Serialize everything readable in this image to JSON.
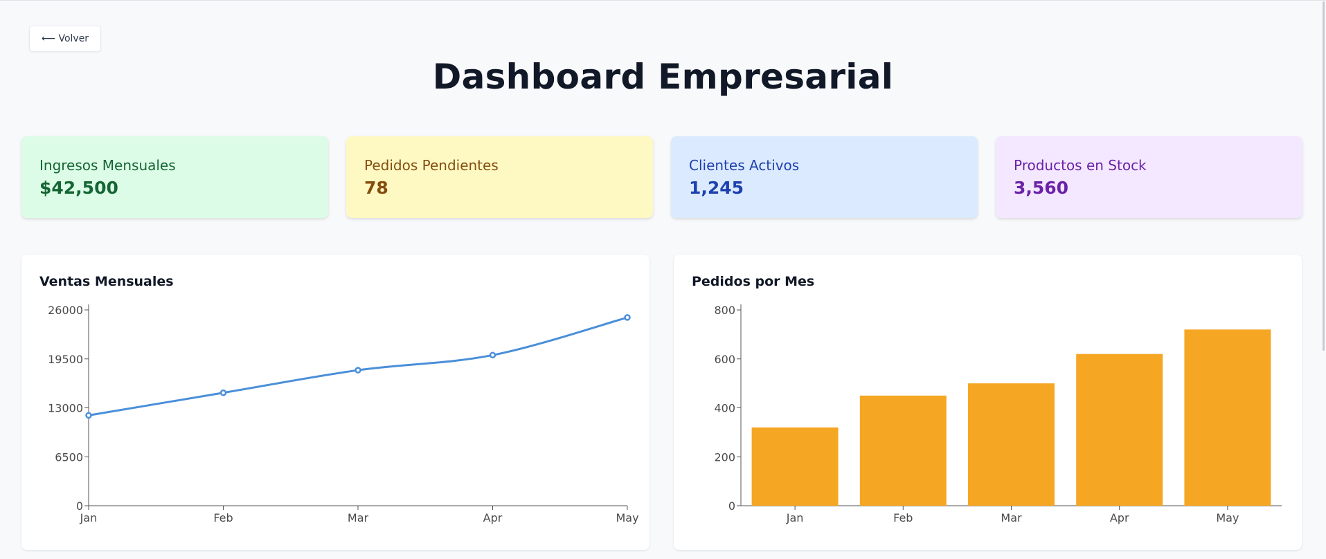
{
  "nav": {
    "back_label": "⟵ Volver"
  },
  "page": {
    "title": "Dashboard Empresarial"
  },
  "colors": {
    "line": "#4a8fd9",
    "bar": "#f5a623",
    "axis": "#555555"
  },
  "stats": [
    {
      "label": "Ingresos Mensuales",
      "value": "$42,500",
      "bg": "#dcfce7",
      "fg": "#166534"
    },
    {
      "label": "Pedidos Pendientes",
      "value": "78",
      "bg": "#fef9c3",
      "fg": "#854d0e"
    },
    {
      "label": "Clientes Activos",
      "value": "1,245",
      "bg": "#dbeafe",
      "fg": "#1e40af"
    },
    {
      "label": "Productos en Stock",
      "value": "3,560",
      "bg": "#f3e8ff",
      "fg": "#6b21a8"
    }
  ],
  "panels": {
    "sales_title": "Ventas Mensuales",
    "orders_title": "Pedidos por Mes"
  },
  "chart_data": [
    {
      "type": "line",
      "title": "Ventas Mensuales",
      "categories": [
        "Jan",
        "Feb",
        "Mar",
        "Apr",
        "May"
      ],
      "values": [
        12000,
        15000,
        18000,
        20000,
        25000
      ],
      "ylim": [
        0,
        26000
      ],
      "yticks": [
        0,
        6500,
        13000,
        19500,
        26000
      ],
      "grid": false,
      "legend": "none"
    },
    {
      "type": "bar",
      "title": "Pedidos por Mes",
      "categories": [
        "Jan",
        "Feb",
        "Mar",
        "Apr",
        "May"
      ],
      "values": [
        320,
        450,
        500,
        620,
        720
      ],
      "ylim": [
        0,
        800
      ],
      "yticks": [
        0,
        200,
        400,
        600,
        800
      ],
      "grid": false,
      "legend": "none"
    }
  ]
}
